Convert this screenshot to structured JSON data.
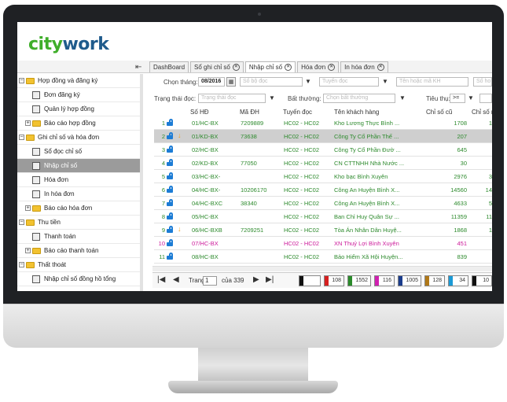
{
  "brand": {
    "part1": "city",
    "part2": "work"
  },
  "sidebar": {
    "items": [
      {
        "label": "Hợp đồng và đăng ký",
        "type": "folder",
        "level": 0
      },
      {
        "label": "Đơn đăng ký",
        "type": "doc",
        "level": 1
      },
      {
        "label": "Quản lý hợp đồng",
        "type": "doc",
        "level": 1
      },
      {
        "label": "Báo cáo hợp đồng",
        "type": "folder",
        "level": 1
      },
      {
        "label": "Ghi chỉ số và hóa đơn",
        "type": "folder",
        "level": 0
      },
      {
        "label": "Sổ đọc chỉ số",
        "type": "doc",
        "level": 1
      },
      {
        "label": "Nhập chỉ số",
        "type": "doc",
        "level": 1,
        "selected": true
      },
      {
        "label": "Hóa đơn",
        "type": "doc",
        "level": 1
      },
      {
        "label": "In hóa đơn",
        "type": "doc",
        "level": 1
      },
      {
        "label": "Báo cáo hóa đơn",
        "type": "folder",
        "level": 1
      },
      {
        "label": "Thu tiền",
        "type": "folder",
        "level": 0
      },
      {
        "label": "Thanh toán",
        "type": "doc",
        "level": 1
      },
      {
        "label": "Báo cáo thanh toán",
        "type": "folder",
        "level": 1
      },
      {
        "label": "Thất thoát",
        "type": "folder",
        "level": 0
      },
      {
        "label": "Nhập chỉ số đồng hồ tổng",
        "type": "doc",
        "level": 1
      }
    ]
  },
  "tabs": [
    {
      "label": "DashBoard",
      "closable": false
    },
    {
      "label": "Sổ ghi chỉ số",
      "closable": true
    },
    {
      "label": "Nhập chỉ số",
      "closable": true,
      "active": true
    },
    {
      "label": "Hóa đơn",
      "closable": true
    },
    {
      "label": "In hóa đơn",
      "closable": true
    }
  ],
  "filters": {
    "month_label": "Chọn tháng:",
    "month_value": "08/2016",
    "reader_placeholder": "Sổ bộ đọc",
    "route_placeholder": "Tuyến đọc",
    "customer_placeholder": "Tên hoặc mã KH",
    "extra_placeholder": "Số ho",
    "status_label": "Trạng thái đọc:",
    "status_placeholder": "Trạng thái đọc",
    "abnormal_label": "Bất thường:",
    "abnormal_placeholder": "Chọn bất thường",
    "usage_label": "Tiêu thụ:",
    "usage_op": ">="
  },
  "grid": {
    "columns": [
      "Số HĐ",
      "Mã ĐH",
      "Tuyến đọc",
      "Tên khách hàng",
      "Chỉ số cũ",
      "Chỉ số m"
    ],
    "rows": [
      {
        "n": "1",
        "so_hd": "01/HC-BX",
        "ma_dh": "7209889",
        "tuyen": "HC02 - HC02",
        "ten": "Kho Lương Thực Bình ...",
        "cu": "1708",
        "moi": "1",
        "arrow": false,
        "color": "#2d8a2d"
      },
      {
        "n": "2",
        "so_hd": "01/KD-BX",
        "ma_dh": "73638",
        "tuyen": "HC02 - HC02",
        "ten": "Công Ty Cổ Phần Thế ...",
        "cu": "207",
        "moi": "",
        "arrow": true,
        "color": "#2d8a2d",
        "selected": true
      },
      {
        "n": "3",
        "so_hd": "02/HC-BX",
        "ma_dh": "",
        "tuyen": "HC02 - HC02",
        "ten": "Công Ty Cổ Phần Đườ ...",
        "cu": "645",
        "moi": "",
        "arrow": false,
        "color": "#2d8a2d"
      },
      {
        "n": "4",
        "so_hd": "02/KD-BX",
        "ma_dh": "77050",
        "tuyen": "HC02 - HC02",
        "ten": "CN CTTNHH Nhà Nước ...",
        "cu": "30",
        "moi": "",
        "arrow": false,
        "color": "#2d8a2d"
      },
      {
        "n": "5",
        "so_hd": "03/HC-BX-",
        "ma_dh": "",
        "tuyen": "HC02 - HC02",
        "ten": "Kho bạc Bình Xuyên",
        "cu": "2976",
        "moi": "3",
        "arrow": false,
        "color": "#2d8a2d"
      },
      {
        "n": "6",
        "so_hd": "04/HC-BX-",
        "ma_dh": "10206170",
        "tuyen": "HC02 - HC02",
        "ten": "Công An Huyện Bình X...",
        "cu": "14560",
        "moi": "14",
        "arrow": false,
        "color": "#2d8a2d"
      },
      {
        "n": "7",
        "so_hd": "04/HC-BXC",
        "ma_dh": "38340",
        "tuyen": "HC02 - HC02",
        "ten": "Công An Huyện Bình X...",
        "cu": "4633",
        "moi": "5",
        "arrow": false,
        "color": "#2d8a2d"
      },
      {
        "n": "8",
        "so_hd": "05/HC-BX",
        "ma_dh": "",
        "tuyen": "HC02 - HC02",
        "ten": "Ban Chỉ Huy Quân Sự ...",
        "cu": "11359",
        "moi": "11",
        "arrow": false,
        "color": "#2d8a2d"
      },
      {
        "n": "9",
        "so_hd": "06/HC-BXB",
        "ma_dh": "7209251",
        "tuyen": "HC02 - HC02",
        "ten": "Tòa Án Nhân Dân Huyệ...",
        "cu": "1868",
        "moi": "1",
        "arrow": true,
        "color": "#2d8a2d"
      },
      {
        "n": "10",
        "so_hd": "07/HC-BX",
        "ma_dh": "",
        "tuyen": "HC02 - HC02",
        "ten": "XN Thuỷ Lợi Bình Xuyên",
        "cu": "451",
        "moi": "",
        "arrow": false,
        "color": "#cc1a9a"
      },
      {
        "n": "11",
        "so_hd": "08/HC-BX",
        "ma_dh": "",
        "tuyen": "HC02 - HC02",
        "ten": "Bảo Hiểm Xã Hội Huyện...",
        "cu": "839",
        "moi": "",
        "arrow": false,
        "color": "#2d8a2d"
      }
    ]
  },
  "pager": {
    "page_label": "Trang",
    "page_value": "1",
    "of_label": "của 339",
    "badges": [
      {
        "value": "",
        "color": "#111"
      },
      {
        "value": "108",
        "color": "#d62020"
      },
      {
        "value": "1552",
        "color": "#2a8a2a"
      },
      {
        "value": "116",
        "color": "#d020b0"
      },
      {
        "value": "1005",
        "color": "#1a3c8c"
      },
      {
        "value": "128",
        "color": "#b07818"
      },
      {
        "value": "34",
        "color": "#1a9ad6"
      },
      {
        "value": "10",
        "color": "#111"
      }
    ]
  }
}
